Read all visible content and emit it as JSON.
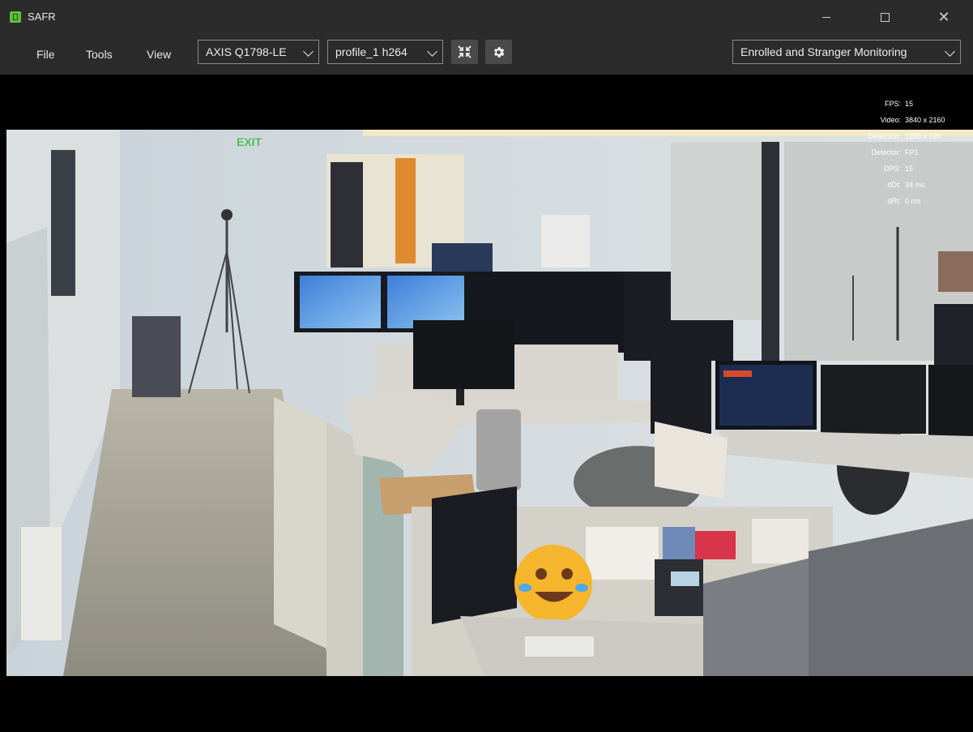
{
  "app": {
    "title": "SAFR"
  },
  "window_controls": {
    "minimize": "—",
    "maximize": "",
    "close": "✕"
  },
  "menu": {
    "file": "File",
    "tools": "Tools",
    "view": "View"
  },
  "toolbar": {
    "camera_select": "AXIS Q1798-LE",
    "profile_select": "profile_1 h264",
    "mode_select": "Enrolled and Stranger Monitoring",
    "fit_icon": "collapse-arrows-icon",
    "settings_icon": "gear-icon"
  },
  "stats": [
    {
      "key": "FPS:",
      "value": "15"
    },
    {
      "key": "Video:",
      "value": "3840 x 2160"
    },
    {
      "key": "Detection:",
      "value": "1280 x 720"
    },
    {
      "key": "Detector:",
      "value": "FP1"
    },
    {
      "key": "DPS:",
      "value": "15"
    },
    {
      "key": "dDt:",
      "value": "34 ms"
    },
    {
      "key": "dRt:",
      "value": "0 ms"
    }
  ],
  "scene": {
    "exit_sign": "EXIT"
  },
  "colors": {
    "accent_green": "#5fbf3b",
    "chrome": "#2b2b2b"
  }
}
